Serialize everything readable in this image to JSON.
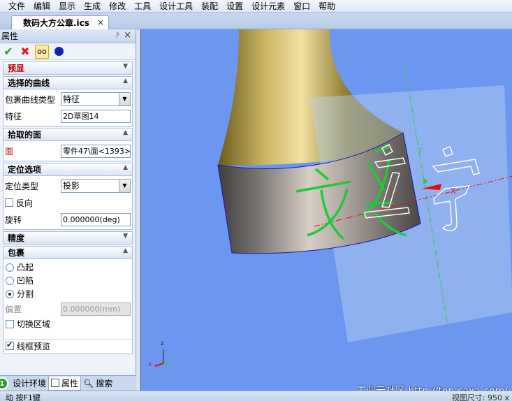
{
  "menu": [
    "文件",
    "编辑",
    "显示",
    "生成",
    "修改",
    "工具",
    "设计工具",
    "装配",
    "设置",
    "设计元素",
    "窗口",
    "帮助"
  ],
  "doc_tab": {
    "title": "数码大方公章.ics",
    "close": "×"
  },
  "panel": {
    "title": "属性",
    "pin": "ᚹ",
    "close": "×",
    "toolbar": {
      "ok": "✔",
      "cancel": "✖",
      "preview": "oo"
    },
    "sections": {
      "preview": "预显",
      "curve": {
        "header": "选择的曲线",
        "wrap_type_label": "包裹曲线类型",
        "wrap_type_value": "特征",
        "feature_label": "特征",
        "feature_value": "2D草图14"
      },
      "face": {
        "header": "拾取的面",
        "face_label": "面",
        "face_value": "零件47\\面<1393>"
      },
      "position": {
        "header": "定位选项",
        "type_label": "定位类型",
        "type_value": "投影",
        "reverse_label": "反向",
        "rotate_label": "旋转",
        "rotate_value": "0.000000(deg)"
      },
      "precision": "精度",
      "wrap": {
        "header": "包裹",
        "option_raise": "凸起",
        "option_sink": "凹陷",
        "option_split": "分割",
        "offset_label": "偏置",
        "offset_value": "0.000000(mm)",
        "switch_label": "切换区域",
        "wire_label": "线框预览"
      }
    }
  },
  "bottom_tabs": [
    "设计环境",
    "属性",
    "搜索"
  ],
  "status": {
    "left": "动 按F1键",
    "right": "视图尺寸: 950 x"
  },
  "watermark": "工业云社区 http://top.caxa.com/",
  "viewport": {
    "axis_z": "z",
    "axis_x": "x",
    "axis_x_red": "X",
    "axis_y": "Y",
    "colors": {
      "background": "#6d96f0",
      "sketch": "#22c83a",
      "wire": "#ffffff"
    }
  }
}
